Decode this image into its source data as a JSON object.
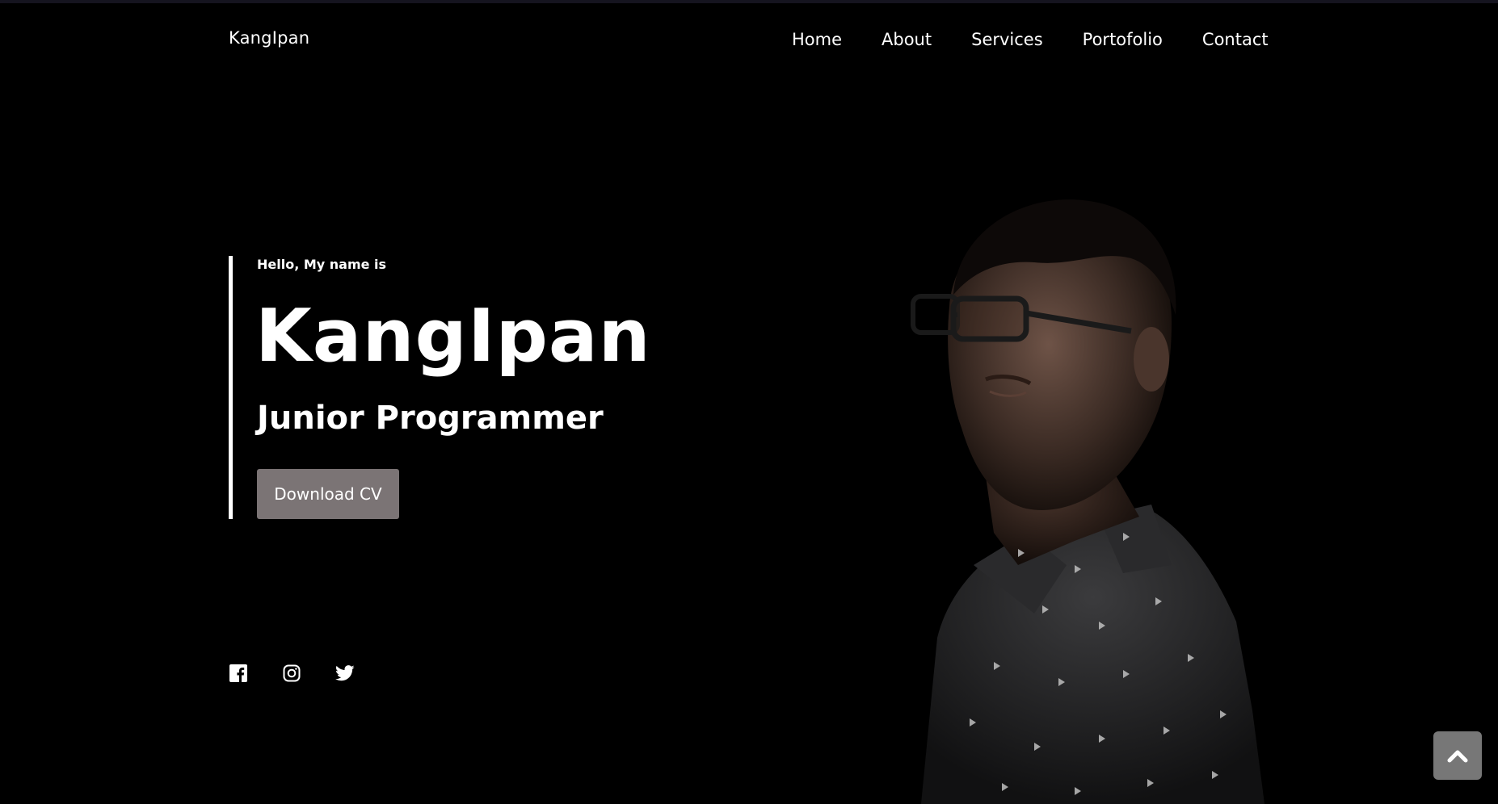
{
  "header": {
    "brand": "KangIpan",
    "nav": [
      {
        "label": "Home"
      },
      {
        "label": "About"
      },
      {
        "label": "Services"
      },
      {
        "label": "Portofolio"
      },
      {
        "label": "Contact"
      }
    ]
  },
  "hero": {
    "greeting": "Hello, My name is",
    "name": "KangIpan",
    "role": "Junior Programmer",
    "cta_label": "Download CV"
  },
  "social": [
    {
      "icon": "facebook-icon"
    },
    {
      "icon": "instagram-icon"
    },
    {
      "icon": "twitter-icon"
    }
  ],
  "back_to_top_icon": "chevron-up-icon",
  "colors": {
    "background": "#000000",
    "text": "#ffffff",
    "button": "#7b7475",
    "back_to_top": "#777777"
  }
}
